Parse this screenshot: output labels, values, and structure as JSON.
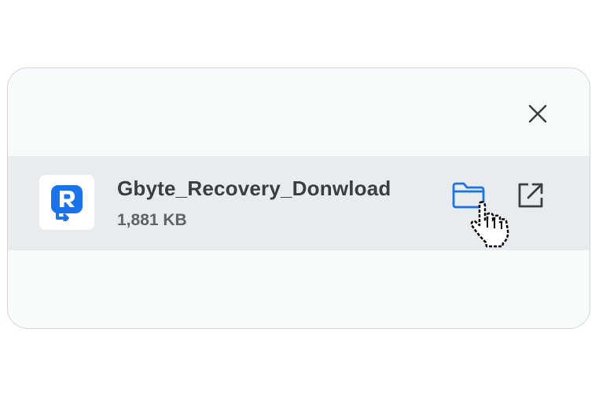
{
  "download": {
    "file_name": "Gbyte_Recovery_Donwload",
    "file_size": "1,881 KB"
  },
  "icons": {
    "app": "gbyte-recovery-app-icon",
    "close": "close-icon",
    "folder": "folder-icon",
    "open": "open-external-icon",
    "cursor": "hand-pointer-cursor-icon"
  },
  "colors": {
    "panel_background": "#f7fbfc",
    "row_background": "#e8ecee",
    "accent_blue": "#1a73e8",
    "icon_gray": "#3c4043"
  }
}
